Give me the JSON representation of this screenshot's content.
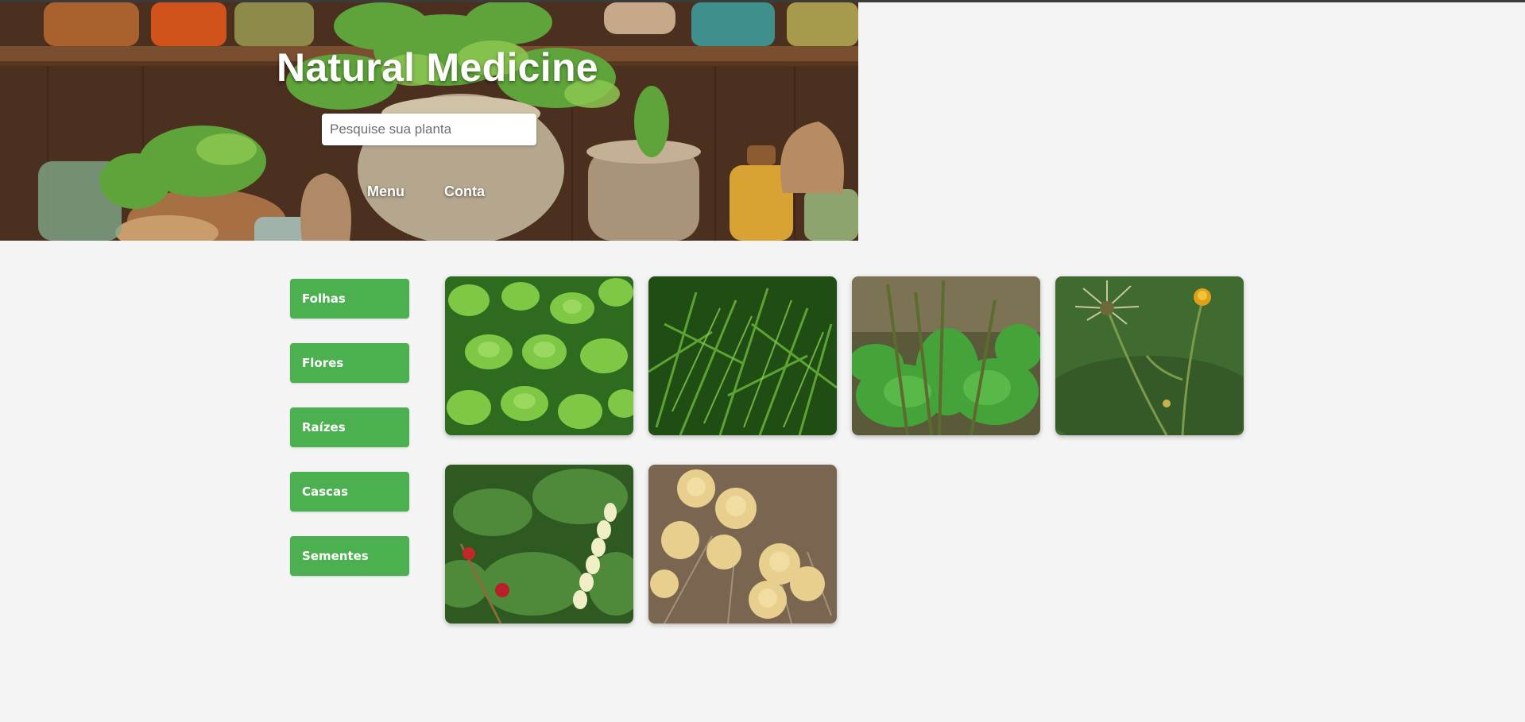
{
  "header": {
    "title": "Natural Medicine",
    "search_placeholder": "Pesquise sua planta",
    "nav": [
      "Menu",
      "Conta"
    ]
  },
  "categories": [
    "Folhas",
    "Flores",
    "Raízes",
    "Cascas",
    "Sementes"
  ],
  "gallery": [
    {
      "name": "mint-leaves-image"
    },
    {
      "name": "fern-foliage-image"
    },
    {
      "name": "plantain-image"
    },
    {
      "name": "wild-flower-image"
    },
    {
      "name": "spike-berry-image"
    },
    {
      "name": "yellow-blossom-image"
    }
  ],
  "colors": {
    "accent": "#4caf50",
    "background": "#f4f4f4",
    "header_text": "#ffffff"
  }
}
